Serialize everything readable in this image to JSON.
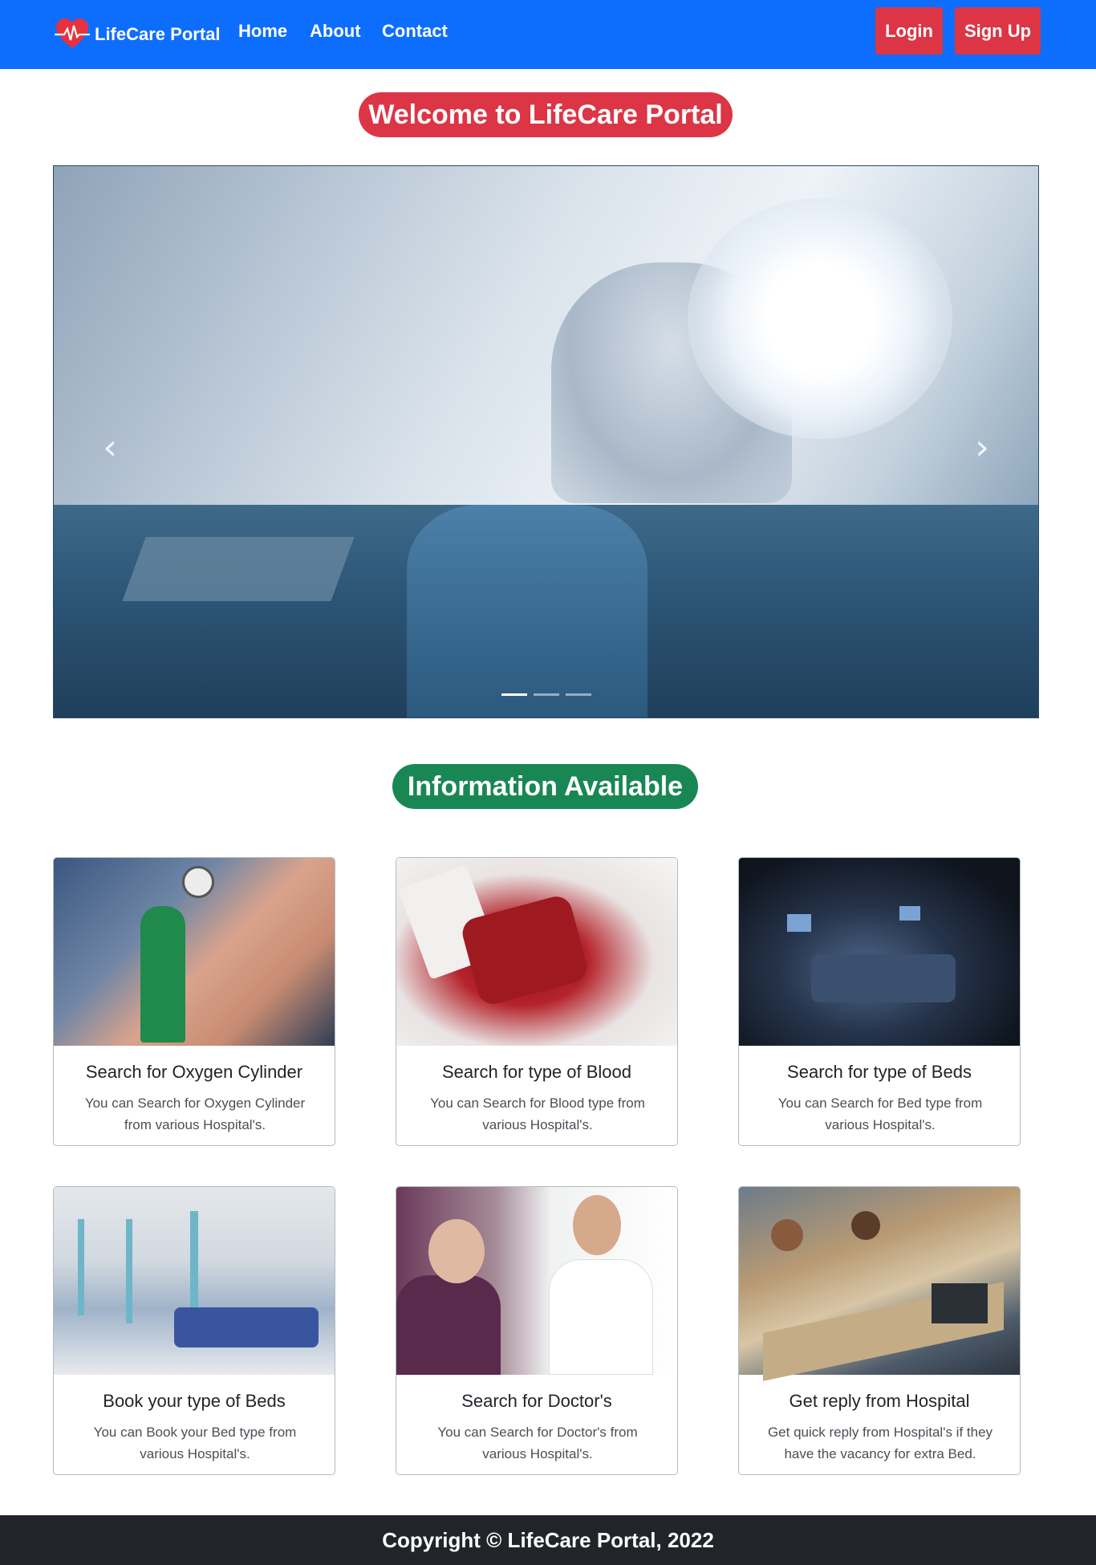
{
  "nav": {
    "brand": "LifeCare Portal",
    "links": [
      "Home",
      "About",
      "Contact"
    ],
    "login": "Login",
    "signup": "Sign Up"
  },
  "hero_title": "Welcome to LifeCare Portal",
  "carousel": {
    "indicators": 3,
    "active_index": 0,
    "prev_icon": "chevron-left-icon",
    "next_icon": "chevron-right-icon"
  },
  "section_title": "Information Available",
  "cards": [
    {
      "title": "Search for Oxygen Cylinder",
      "line1": "You can Search for Oxygen Cylinder",
      "line2": "from various Hospital's."
    },
    {
      "title": "Search for type of Blood",
      "line1": "You can Search for Blood type from",
      "line2": "various Hospital's."
    },
    {
      "title": "Search for type of Beds",
      "line1": "You can Search for Bed type from",
      "line2": "various Hospital's."
    },
    {
      "title": "Book your type of Beds",
      "line1": "You can Book your Bed type from",
      "line2": "various Hospital's."
    },
    {
      "title": "Search for Doctor's",
      "line1": "You can Search for Doctor's from",
      "line2": "various Hospital's."
    },
    {
      "title": "Get reply from Hospital",
      "line1": "Get quick reply from Hospital's if they",
      "line2": "have the vacancy for extra Bed."
    }
  ],
  "footer": "Copyright © LifeCare Portal, 2022",
  "colors": {
    "primary": "#0d6efd",
    "danger": "#dc3545",
    "success": "#198754",
    "footer_bg": "#212529"
  }
}
